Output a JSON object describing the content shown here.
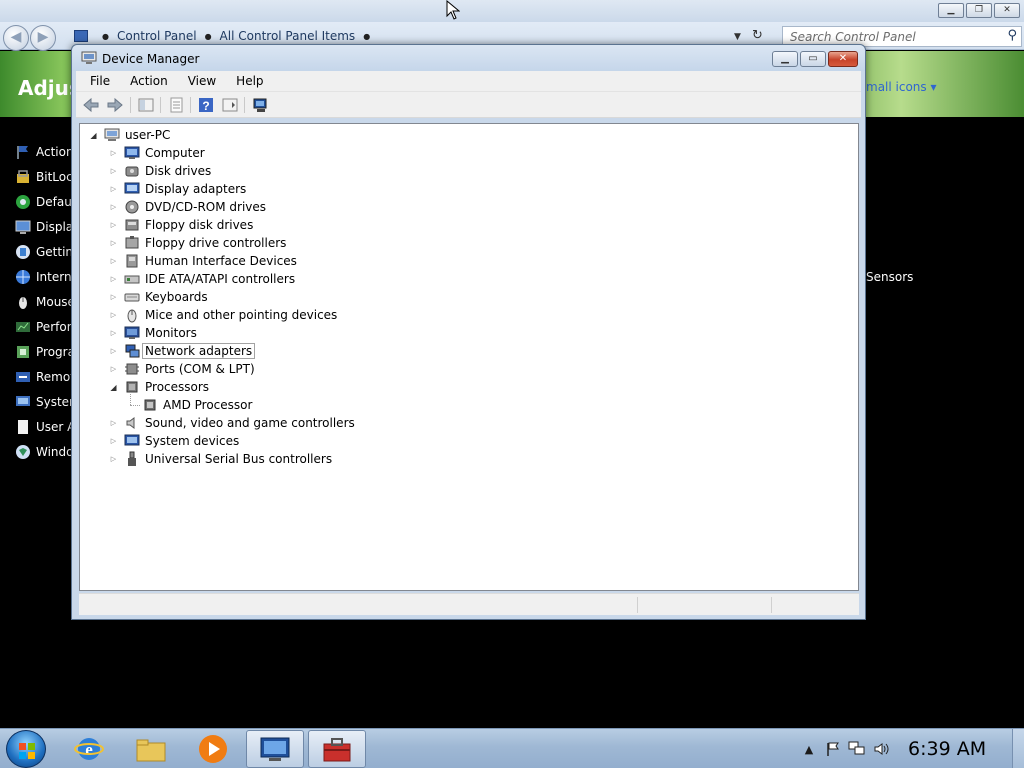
{
  "control_panel": {
    "breadcrumb": [
      "Control Panel",
      "All Control Panel Items"
    ],
    "search_placeholder": "Search Control Panel",
    "banner_title": "Adjus",
    "view_by": "mall icons ▾",
    "side_items": [
      "Action",
      "BitLoc",
      "Defaul",
      "Display",
      "Getting",
      "Interne",
      "Mouse",
      "Perfor",
      "Progra",
      "Remot",
      "System",
      "User A",
      "Windo"
    ],
    "partial_item_right": "Sensors"
  },
  "device_manager": {
    "title": "Device Manager",
    "menu": [
      "File",
      "Action",
      "View",
      "Help"
    ],
    "root": "user-PC",
    "categories": [
      {
        "label": "Computer",
        "expanded": false
      },
      {
        "label": "Disk drives",
        "expanded": false
      },
      {
        "label": "Display adapters",
        "expanded": false
      },
      {
        "label": "DVD/CD-ROM drives",
        "expanded": false
      },
      {
        "label": "Floppy disk drives",
        "expanded": false
      },
      {
        "label": "Floppy drive controllers",
        "expanded": false
      },
      {
        "label": "Human Interface Devices",
        "expanded": false
      },
      {
        "label": "IDE ATA/ATAPI controllers",
        "expanded": false
      },
      {
        "label": "Keyboards",
        "expanded": false
      },
      {
        "label": "Mice and other pointing devices",
        "expanded": false
      },
      {
        "label": "Monitors",
        "expanded": false
      },
      {
        "label": "Network adapters",
        "expanded": false,
        "focused": true
      },
      {
        "label": "Ports (COM & LPT)",
        "expanded": false
      },
      {
        "label": "Processors",
        "expanded": true,
        "children": [
          "AMD Processor"
        ]
      },
      {
        "label": "Sound, video and game controllers",
        "expanded": false
      },
      {
        "label": "System devices",
        "expanded": false
      },
      {
        "label": "Universal Serial Bus controllers",
        "expanded": false
      }
    ]
  },
  "taskbar": {
    "clock": "6:39 AM"
  }
}
